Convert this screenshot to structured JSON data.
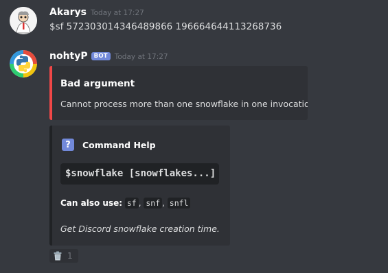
{
  "messages": [
    {
      "author": "Akarys",
      "timestamp": "Today at 17:27",
      "content": "$sf 572303014346489866 196664644113268736"
    },
    {
      "author": "nohtyP",
      "bot_tag": "BOT",
      "timestamp": "Today at 17:27"
    }
  ],
  "embeds": {
    "error": {
      "accent": "#f04747",
      "title": "Bad argument",
      "description": "Cannot process more than one snowflake in one invocation."
    },
    "help": {
      "accent": "#202225",
      "icon": "question-icon",
      "icon_glyph": "?",
      "author": "Command Help",
      "usage": "$snowflake [snowflakes...]",
      "aliases_label": "Can also use:",
      "aliases": [
        "sf",
        "snf",
        "snfl"
      ],
      "description": "Get Discord snowflake creation time."
    }
  },
  "reaction": {
    "emoji": "wastebasket-icon",
    "count": "1"
  },
  "colors": {
    "background": "#36393f",
    "embed_background": "#2f3136",
    "blurple": "#7289da",
    "muted": "#72767d"
  }
}
